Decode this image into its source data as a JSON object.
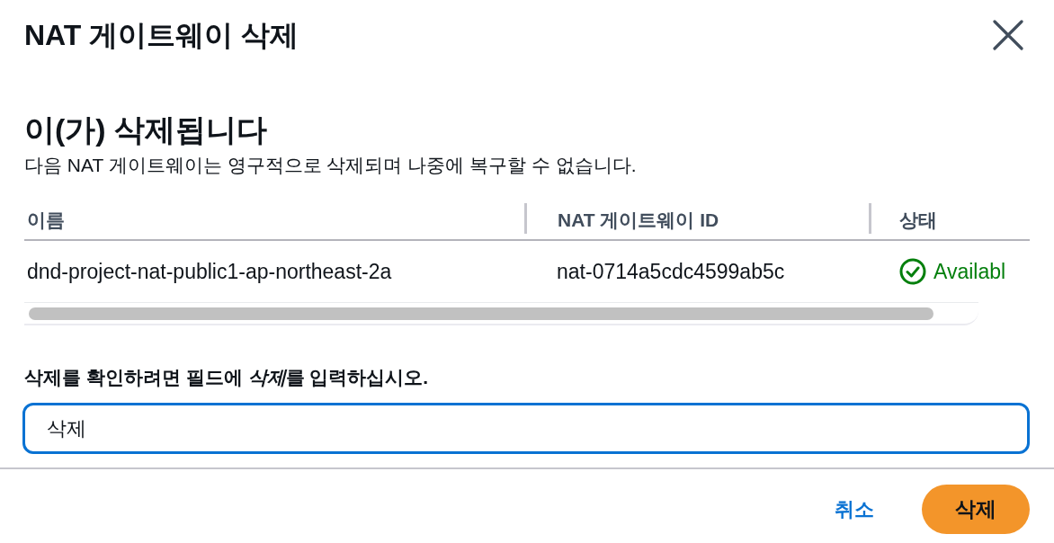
{
  "dialog": {
    "title": "NAT 게이트웨이 삭제"
  },
  "warning": {
    "heading": "이(가) 삭제됩니다",
    "description": "다음 NAT 게이트웨이는 영구적으로 삭제되며 나중에 복구할 수 없습니다."
  },
  "table": {
    "columns": [
      "이름",
      "NAT 게이트웨이 ID",
      "상태"
    ],
    "rows": [
      {
        "name": "dnd-project-nat-public1-ap-northeast-2a",
        "id": "nat-0714a5cdc4599ab5c",
        "status": {
          "kind": "available",
          "text": "Availabl"
        }
      }
    ]
  },
  "confirm": {
    "label": [
      {
        "text": "삭제를 확인하려면 필드에 ",
        "italic": false
      },
      {
        "text": "삭제",
        "italic": true
      },
      {
        "text": "를 입력하십시오.",
        "italic": false
      }
    ],
    "value": "삭제"
  },
  "footer": {
    "cancel": "취소",
    "submit": "삭제"
  }
}
